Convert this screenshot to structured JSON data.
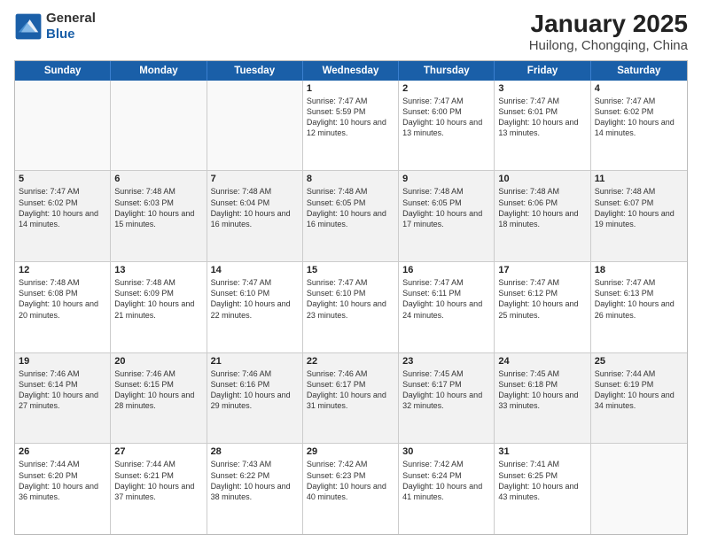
{
  "logo": {
    "line1": "General",
    "line2": "Blue"
  },
  "title": "January 2025",
  "subtitle": "Huilong, Chongqing, China",
  "days": [
    "Sunday",
    "Monday",
    "Tuesday",
    "Wednesday",
    "Thursday",
    "Friday",
    "Saturday"
  ],
  "weeks": [
    [
      {
        "day": "",
        "info": ""
      },
      {
        "day": "",
        "info": ""
      },
      {
        "day": "",
        "info": ""
      },
      {
        "day": "1",
        "info": "Sunrise: 7:47 AM\nSunset: 5:59 PM\nDaylight: 10 hours and 12 minutes."
      },
      {
        "day": "2",
        "info": "Sunrise: 7:47 AM\nSunset: 6:00 PM\nDaylight: 10 hours and 13 minutes."
      },
      {
        "day": "3",
        "info": "Sunrise: 7:47 AM\nSunset: 6:01 PM\nDaylight: 10 hours and 13 minutes."
      },
      {
        "day": "4",
        "info": "Sunrise: 7:47 AM\nSunset: 6:02 PM\nDaylight: 10 hours and 14 minutes."
      }
    ],
    [
      {
        "day": "5",
        "info": "Sunrise: 7:47 AM\nSunset: 6:02 PM\nDaylight: 10 hours and 14 minutes."
      },
      {
        "day": "6",
        "info": "Sunrise: 7:48 AM\nSunset: 6:03 PM\nDaylight: 10 hours and 15 minutes."
      },
      {
        "day": "7",
        "info": "Sunrise: 7:48 AM\nSunset: 6:04 PM\nDaylight: 10 hours and 16 minutes."
      },
      {
        "day": "8",
        "info": "Sunrise: 7:48 AM\nSunset: 6:05 PM\nDaylight: 10 hours and 16 minutes."
      },
      {
        "day": "9",
        "info": "Sunrise: 7:48 AM\nSunset: 6:05 PM\nDaylight: 10 hours and 17 minutes."
      },
      {
        "day": "10",
        "info": "Sunrise: 7:48 AM\nSunset: 6:06 PM\nDaylight: 10 hours and 18 minutes."
      },
      {
        "day": "11",
        "info": "Sunrise: 7:48 AM\nSunset: 6:07 PM\nDaylight: 10 hours and 19 minutes."
      }
    ],
    [
      {
        "day": "12",
        "info": "Sunrise: 7:48 AM\nSunset: 6:08 PM\nDaylight: 10 hours and 20 minutes."
      },
      {
        "day": "13",
        "info": "Sunrise: 7:48 AM\nSunset: 6:09 PM\nDaylight: 10 hours and 21 minutes."
      },
      {
        "day": "14",
        "info": "Sunrise: 7:47 AM\nSunset: 6:10 PM\nDaylight: 10 hours and 22 minutes."
      },
      {
        "day": "15",
        "info": "Sunrise: 7:47 AM\nSunset: 6:10 PM\nDaylight: 10 hours and 23 minutes."
      },
      {
        "day": "16",
        "info": "Sunrise: 7:47 AM\nSunset: 6:11 PM\nDaylight: 10 hours and 24 minutes."
      },
      {
        "day": "17",
        "info": "Sunrise: 7:47 AM\nSunset: 6:12 PM\nDaylight: 10 hours and 25 minutes."
      },
      {
        "day": "18",
        "info": "Sunrise: 7:47 AM\nSunset: 6:13 PM\nDaylight: 10 hours and 26 minutes."
      }
    ],
    [
      {
        "day": "19",
        "info": "Sunrise: 7:46 AM\nSunset: 6:14 PM\nDaylight: 10 hours and 27 minutes."
      },
      {
        "day": "20",
        "info": "Sunrise: 7:46 AM\nSunset: 6:15 PM\nDaylight: 10 hours and 28 minutes."
      },
      {
        "day": "21",
        "info": "Sunrise: 7:46 AM\nSunset: 6:16 PM\nDaylight: 10 hours and 29 minutes."
      },
      {
        "day": "22",
        "info": "Sunrise: 7:46 AM\nSunset: 6:17 PM\nDaylight: 10 hours and 31 minutes."
      },
      {
        "day": "23",
        "info": "Sunrise: 7:45 AM\nSunset: 6:17 PM\nDaylight: 10 hours and 32 minutes."
      },
      {
        "day": "24",
        "info": "Sunrise: 7:45 AM\nSunset: 6:18 PM\nDaylight: 10 hours and 33 minutes."
      },
      {
        "day": "25",
        "info": "Sunrise: 7:44 AM\nSunset: 6:19 PM\nDaylight: 10 hours and 34 minutes."
      }
    ],
    [
      {
        "day": "26",
        "info": "Sunrise: 7:44 AM\nSunset: 6:20 PM\nDaylight: 10 hours and 36 minutes."
      },
      {
        "day": "27",
        "info": "Sunrise: 7:44 AM\nSunset: 6:21 PM\nDaylight: 10 hours and 37 minutes."
      },
      {
        "day": "28",
        "info": "Sunrise: 7:43 AM\nSunset: 6:22 PM\nDaylight: 10 hours and 38 minutes."
      },
      {
        "day": "29",
        "info": "Sunrise: 7:42 AM\nSunset: 6:23 PM\nDaylight: 10 hours and 40 minutes."
      },
      {
        "day": "30",
        "info": "Sunrise: 7:42 AM\nSunset: 6:24 PM\nDaylight: 10 hours and 41 minutes."
      },
      {
        "day": "31",
        "info": "Sunrise: 7:41 AM\nSunset: 6:25 PM\nDaylight: 10 hours and 43 minutes."
      },
      {
        "day": "",
        "info": ""
      }
    ]
  ]
}
